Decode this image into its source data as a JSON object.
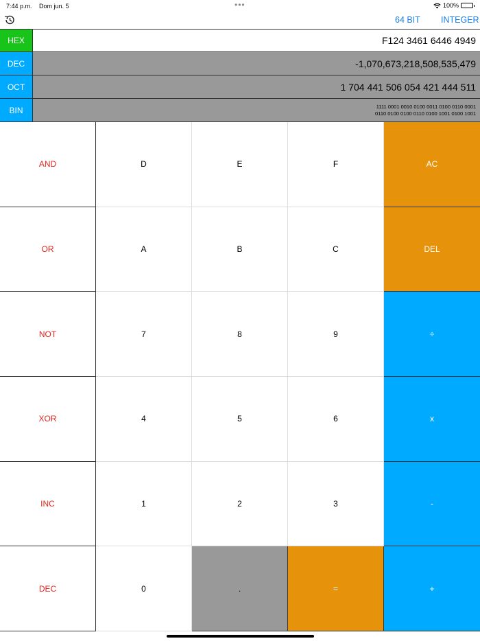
{
  "status": {
    "time": "7:44 p.m.",
    "date": "Dom jun. 5",
    "battery": "100%"
  },
  "toolbar": {
    "bit_label": "64 BIT",
    "mode_label": "INTEGER"
  },
  "display": [
    {
      "label": "HEX",
      "color": "#18c31a",
      "value": "F124 3461 6446 4949",
      "bg": "#ffffff"
    },
    {
      "label": "DEC",
      "color": "#00aaff",
      "value": "-1,070,673,218,508,535,479",
      "bg": "#999999"
    },
    {
      "label": "OCT",
      "color": "#00aaff",
      "value": "1 704 441 506 054 421 444 511",
      "bg": "#999999"
    },
    {
      "label": "BIN",
      "color": "#00aaff",
      "value_line1": "1111 0001 0010 0100 0011 0100 0110 0001",
      "value_line2": "0110 0100 0100 0110 0100 1001 0100 1001",
      "bg": "#999999"
    }
  ],
  "keys": [
    {
      "label": "AND",
      "style": "op-left"
    },
    {
      "label": "D",
      "style": ""
    },
    {
      "label": "E",
      "style": ""
    },
    {
      "label": "F",
      "style": ""
    },
    {
      "label": "AC",
      "style": "orange"
    },
    {
      "label": "OR",
      "style": "op-left"
    },
    {
      "label": "A",
      "style": ""
    },
    {
      "label": "B",
      "style": ""
    },
    {
      "label": "C",
      "style": ""
    },
    {
      "label": "DEL",
      "style": "orange"
    },
    {
      "label": "NOT",
      "style": "op-left"
    },
    {
      "label": "7",
      "style": ""
    },
    {
      "label": "8",
      "style": ""
    },
    {
      "label": "9",
      "style": ""
    },
    {
      "label": "÷",
      "style": "blue"
    },
    {
      "label": "XOR",
      "style": "op-left"
    },
    {
      "label": "4",
      "style": ""
    },
    {
      "label": "5",
      "style": ""
    },
    {
      "label": "6",
      "style": ""
    },
    {
      "label": "x",
      "style": "blue"
    },
    {
      "label": "INC",
      "style": "op-left"
    },
    {
      "label": "1",
      "style": ""
    },
    {
      "label": "2",
      "style": ""
    },
    {
      "label": "3",
      "style": ""
    },
    {
      "label": "-",
      "style": "blue"
    },
    {
      "label": "DEC",
      "style": "op-left"
    },
    {
      "label": "0",
      "style": ""
    },
    {
      "label": ".",
      "style": "gray"
    },
    {
      "label": "=",
      "style": "orange"
    },
    {
      "label": "+",
      "style": "blue"
    }
  ]
}
